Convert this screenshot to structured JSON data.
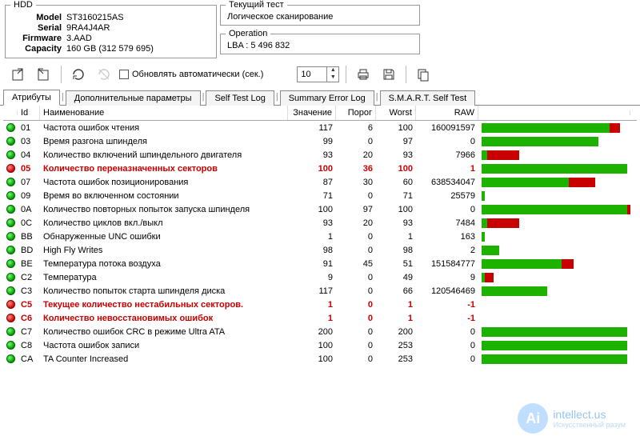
{
  "hdd": {
    "panel_title": "HDD",
    "labels": {
      "model": "Model",
      "serial": "Serial",
      "firmware": "Firmware",
      "capacity": "Capacity"
    },
    "model": "ST3160215AS",
    "serial": "9RA4J4AR",
    "firmware": "3.AAD",
    "capacity": "160 GB (312 579 695)"
  },
  "current_test": {
    "panel_title": "Текущий тест",
    "value": "Логическое сканирование"
  },
  "operation": {
    "panel_title": "Operation",
    "value": "LBA : 5 496 832"
  },
  "toolbar": {
    "auto_refresh_label": "Обновлять автоматически (сек.)",
    "interval_value": "10"
  },
  "tabs": [
    {
      "label": "Атрибуты",
      "active": true
    },
    {
      "label": "Дополнительные параметры",
      "active": false
    },
    {
      "label": "Self Test Log",
      "active": false
    },
    {
      "label": "Summary Error Log",
      "active": false
    },
    {
      "label": "S.M.A.R.T. Self Test",
      "active": false
    }
  ],
  "columns": {
    "led": "",
    "id": "Id",
    "name": "Наименование",
    "value": "Значение",
    "threshold": "Порог",
    "worst": "Worst",
    "raw": "RAW",
    "bar": ""
  },
  "rows": [
    {
      "id": "01",
      "name": "Частота ошибок чтения",
      "value": 117,
      "threshold": 6,
      "worst": 100,
      "raw": "160091597",
      "bad": false,
      "green": 88,
      "red": 7
    },
    {
      "id": "03",
      "name": "Время разгона шпинделя",
      "value": 99,
      "threshold": 0,
      "worst": 97,
      "raw": "0",
      "bad": false,
      "green": 80,
      "red": 0
    },
    {
      "id": "04",
      "name": "Количество включений шпиндельного двигателя",
      "value": 93,
      "threshold": 20,
      "worst": 93,
      "raw": "7966",
      "bad": false,
      "green": 4,
      "red": 22
    },
    {
      "id": "05",
      "name": "Количество переназначенных секторов",
      "value": 100,
      "threshold": 36,
      "worst": 100,
      "raw": "1",
      "bad": true,
      "green": 100,
      "red": 0
    },
    {
      "id": "07",
      "name": "Частота ошибок позиционирования",
      "value": 87,
      "threshold": 30,
      "worst": 60,
      "raw": "638534047",
      "bad": false,
      "green": 60,
      "red": 18
    },
    {
      "id": "09",
      "name": "Время во включенном состоянии",
      "value": 71,
      "threshold": 0,
      "worst": 71,
      "raw": "25579",
      "bad": false,
      "green": 2,
      "red": 0
    },
    {
      "id": "0A",
      "name": "Количество повторных попыток запуска шпинделя",
      "value": 100,
      "threshold": 97,
      "worst": 100,
      "raw": "0",
      "bad": false,
      "green": 100,
      "red": 8
    },
    {
      "id": "0C",
      "name": "Количество циклов вкл./выкл",
      "value": 93,
      "threshold": 20,
      "worst": 93,
      "raw": "7484",
      "bad": false,
      "green": 4,
      "red": 22
    },
    {
      "id": "BB",
      "name": "Обнаруженные UNC ошибки",
      "value": 1,
      "threshold": 0,
      "worst": 1,
      "raw": "163",
      "bad": false,
      "green": 2,
      "red": 0
    },
    {
      "id": "BD",
      "name": "High Fly Writes",
      "value": 98,
      "threshold": 0,
      "worst": 98,
      "raw": "2",
      "bad": false,
      "green": 12,
      "red": 0
    },
    {
      "id": "BE",
      "name": "Температура потока воздуха",
      "value": 91,
      "threshold": 45,
      "worst": 51,
      "raw": "151584777",
      "bad": false,
      "green": 55,
      "red": 8
    },
    {
      "id": "C2",
      "name": "Температура",
      "value": 9,
      "threshold": 0,
      "worst": 49,
      "raw": "9",
      "bad": false,
      "green": 2,
      "red": 6
    },
    {
      "id": "C3",
      "name": "Количество попыток старта шпинделя диска",
      "value": 117,
      "threshold": 0,
      "worst": 66,
      "raw": "120546469",
      "bad": false,
      "green": 45,
      "red": 0
    },
    {
      "id": "C5",
      "name": "Текущее количество нестабильных секторов.",
      "value": 1,
      "threshold": 0,
      "worst": 1,
      "raw": "-1",
      "bad": true,
      "green": 0,
      "red": 0
    },
    {
      "id": "C6",
      "name": "Количество невосстановимых ошибок",
      "value": 1,
      "threshold": 0,
      "worst": 1,
      "raw": "-1",
      "bad": true,
      "green": 0,
      "red": 0
    },
    {
      "id": "C7",
      "name": "Количество ошибок CRC в режиме Ultra ATA",
      "value": 200,
      "threshold": 0,
      "worst": 200,
      "raw": "0",
      "bad": false,
      "green": 100,
      "red": 0
    },
    {
      "id": "C8",
      "name": "Частота ошибок записи",
      "value": 100,
      "threshold": 0,
      "worst": 253,
      "raw": "0",
      "bad": false,
      "green": 100,
      "red": 0
    },
    {
      "id": "CA",
      "name": "TA Counter Increased",
      "value": 100,
      "threshold": 0,
      "worst": 253,
      "raw": "0",
      "bad": false,
      "green": 100,
      "red": 0
    }
  ],
  "watermark": {
    "badge": "Ai",
    "title": "intellect.us",
    "subtitle": "Искусственный разум"
  }
}
